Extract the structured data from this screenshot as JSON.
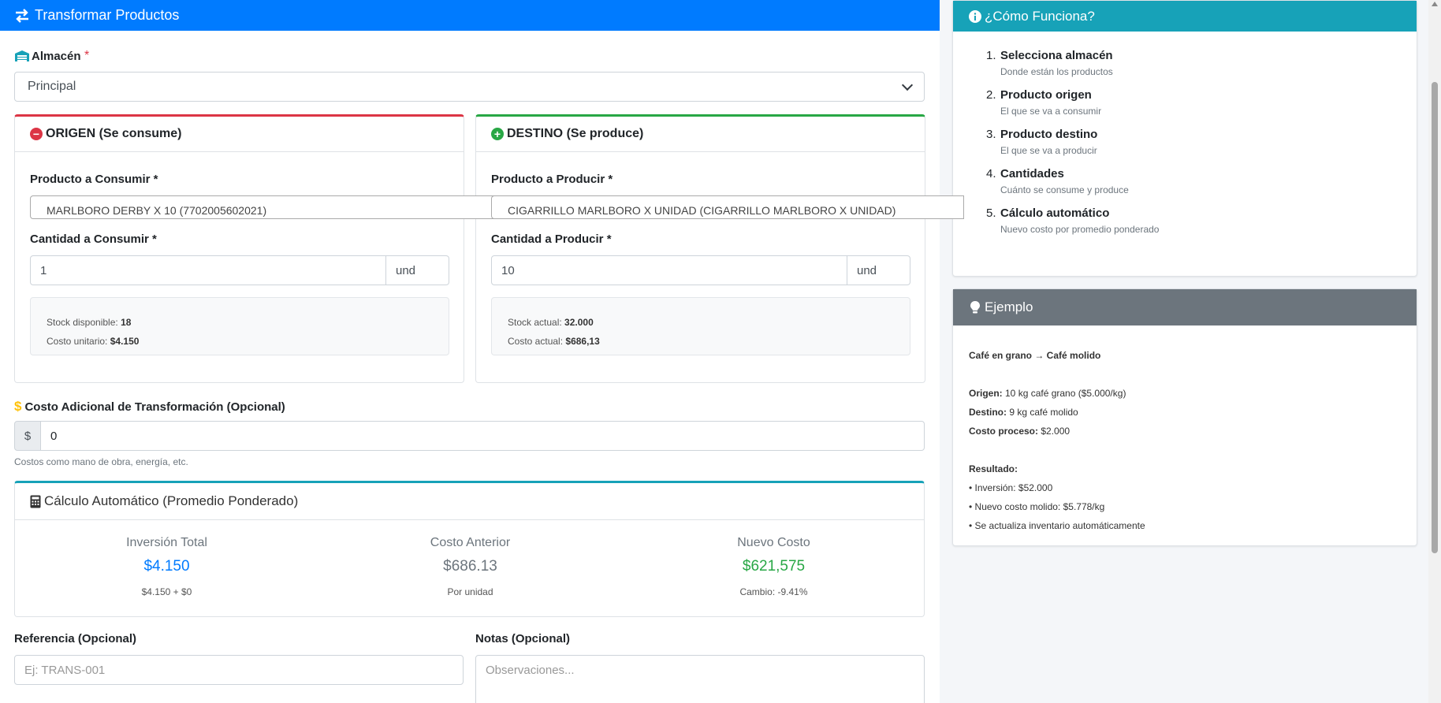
{
  "header": {
    "title": "Transformar Productos",
    "icon": "exchange-icon",
    "color": "#007bff"
  },
  "almacen": {
    "label": "Almacén",
    "required_mark": "*",
    "selected": "Principal"
  },
  "origen": {
    "title": "ORIGEN (Se consume)",
    "product_label": "Producto a Consumir *",
    "product_value": "MARLBORO DERBY X 10 (7702005602021)",
    "qty_label": "Cantidad a Consumir *",
    "qty_value": "1",
    "unit": "und",
    "stock_label": "Stock disponible:",
    "stock_value": "18",
    "cost_label": "Costo unitario:",
    "cost_value": "$4.150"
  },
  "destino": {
    "title": "DESTINO (Se produce)",
    "product_label": "Producto a Producir *",
    "product_value": "CIGARRILLO MARLBORO X UNIDAD (CIGARRILLO MARLBORO X UNIDAD)",
    "qty_label": "Cantidad a Producir *",
    "qty_value": "10",
    "unit": "und",
    "stock_label": "Stock actual:",
    "stock_value": "32.000",
    "cost_label": "Costo actual:",
    "cost_value": "$686,13"
  },
  "costo_adicional": {
    "label": "Costo Adicional de Transformación (Opcional)",
    "prefix": "$",
    "value": "0",
    "help": "Costos como mano de obra, energía, etc."
  },
  "calculo": {
    "title": "Cálculo Automático (Promedio Ponderado)",
    "cols": [
      {
        "title": "Inversión Total",
        "value": "$4.150",
        "sub": "$4.150 + $0"
      },
      {
        "title": "Costo Anterior",
        "value": "$686.13",
        "sub": "Por unidad"
      },
      {
        "title": "Nuevo Costo",
        "value": "$621,575",
        "sub": "Cambio: -9.41%"
      }
    ]
  },
  "referencia": {
    "label": "Referencia (Opcional)",
    "placeholder": "Ej: TRANS-001"
  },
  "notas": {
    "label": "Notas (Opcional)",
    "placeholder": "Observaciones..."
  },
  "como_funciona": {
    "title": "¿Cómo Funciona?",
    "steps": [
      {
        "n": "1.",
        "title": "Selecciona almacén",
        "desc": "Donde están los productos"
      },
      {
        "n": "2.",
        "title": "Producto origen",
        "desc": "El que se va a consumir"
      },
      {
        "n": "3.",
        "title": "Producto destino",
        "desc": "El que se va a producir"
      },
      {
        "n": "4.",
        "title": "Cantidades",
        "desc": "Cuánto se consume y produce"
      },
      {
        "n": "5.",
        "title": "Cálculo automático",
        "desc": "Nuevo costo por promedio ponderado"
      }
    ]
  },
  "ejemplo": {
    "title": "Ejemplo",
    "heading": "Café en grano → Café molido",
    "origen_label": "Origen:",
    "origen_value": " 10 kg café grano ($5.000/kg)",
    "destino_label": "Destino:",
    "destino_value": " 9 kg café molido",
    "proceso_label": "Costo proceso:",
    "proceso_value": " $2.000",
    "resultado_label": "Resultado:",
    "r1": "• Inversión: $52.000",
    "r2": "• Nuevo costo molido: $5.778/kg",
    "r3": "• Se actualiza inventario automáticamente"
  }
}
